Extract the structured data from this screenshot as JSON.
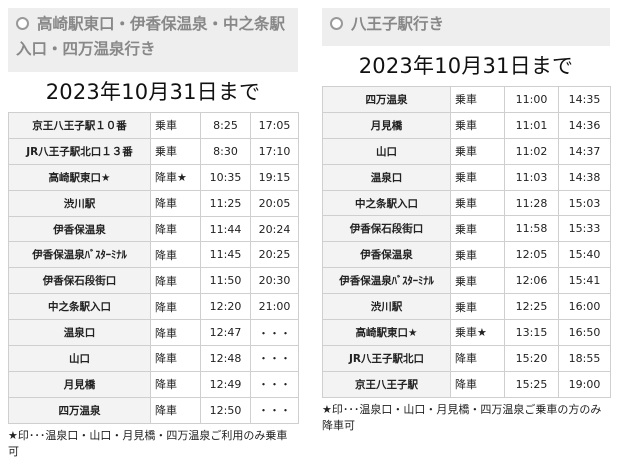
{
  "left": {
    "title": "高崎駅東口・伊香保温泉・中之条駅入口・四万温泉行き",
    "valid_until": "2023年10月31日まで",
    "rows": [
      {
        "stop": "京王八王子駅１０番",
        "type": "乗車",
        "t1": "8:25",
        "t2": "17:05"
      },
      {
        "stop": "JR八王子駅北口１３番",
        "type": "乗車",
        "t1": "8:30",
        "t2": "17:10"
      },
      {
        "stop": "高崎駅東口★",
        "type": "降車★",
        "t1": "10:35",
        "t2": "19:15"
      },
      {
        "stop": "渋川駅",
        "type": "降車",
        "t1": "11:25",
        "t2": "20:05"
      },
      {
        "stop": "伊香保温泉",
        "type": "降車",
        "t1": "11:44",
        "t2": "20:24"
      },
      {
        "stop": "伊香保温泉ﾊﾞｽﾀｰﾐﾅﾙ",
        "type": "降車",
        "t1": "11:45",
        "t2": "20:25"
      },
      {
        "stop": "伊香保石段街口",
        "type": "降車",
        "t1": "11:50",
        "t2": "20:30"
      },
      {
        "stop": "中之条駅入口",
        "type": "降車",
        "t1": "12:20",
        "t2": "21:00"
      },
      {
        "stop": "温泉口",
        "type": "降車",
        "t1": "12:47",
        "t2": "・・・"
      },
      {
        "stop": "山口",
        "type": "降車",
        "t1": "12:48",
        "t2": "・・・"
      },
      {
        "stop": "月見橋",
        "type": "降車",
        "t1": "12:49",
        "t2": "・・・"
      },
      {
        "stop": "四万温泉",
        "type": "降車",
        "t1": "12:50",
        "t2": "・・・"
      }
    ],
    "note": "★印･･･温泉口・山口・月見橋・四万温泉ご利用のみ乗車可"
  },
  "right": {
    "title": "八王子駅行き",
    "valid_until": "2023年10月31日まで",
    "rows": [
      {
        "stop": "四万温泉",
        "type": "乗車",
        "t1": "11:00",
        "t2": "14:35"
      },
      {
        "stop": "月見橋",
        "type": "乗車",
        "t1": "11:01",
        "t2": "14:36"
      },
      {
        "stop": "山口",
        "type": "乗車",
        "t1": "11:02",
        "t2": "14:37"
      },
      {
        "stop": "温泉口",
        "type": "乗車",
        "t1": "11:03",
        "t2": "14:38"
      },
      {
        "stop": "中之条駅入口",
        "type": "乗車",
        "t1": "11:28",
        "t2": "15:03"
      },
      {
        "stop": "伊香保石段街口",
        "type": "乗車",
        "t1": "11:58",
        "t2": "15:33"
      },
      {
        "stop": "伊香保温泉",
        "type": "乗車",
        "t1": "12:05",
        "t2": "15:40"
      },
      {
        "stop": "伊香保温泉ﾊﾞｽﾀｰﾐﾅﾙ",
        "type": "乗車",
        "t1": "12:06",
        "t2": "15:41"
      },
      {
        "stop": "渋川駅",
        "type": "乗車",
        "t1": "12:25",
        "t2": "16:00"
      },
      {
        "stop": "高崎駅東口★",
        "type": "乗車★",
        "t1": "13:15",
        "t2": "16:50"
      },
      {
        "stop": "JR八王子駅北口",
        "type": "降車",
        "t1": "15:20",
        "t2": "18:55"
      },
      {
        "stop": "京王八王子駅",
        "type": "降車",
        "t1": "15:25",
        "t2": "19:00"
      }
    ],
    "note": "★印･･･温泉口・山口・月見橋・四万温泉ご乗車の方のみ降車可"
  }
}
